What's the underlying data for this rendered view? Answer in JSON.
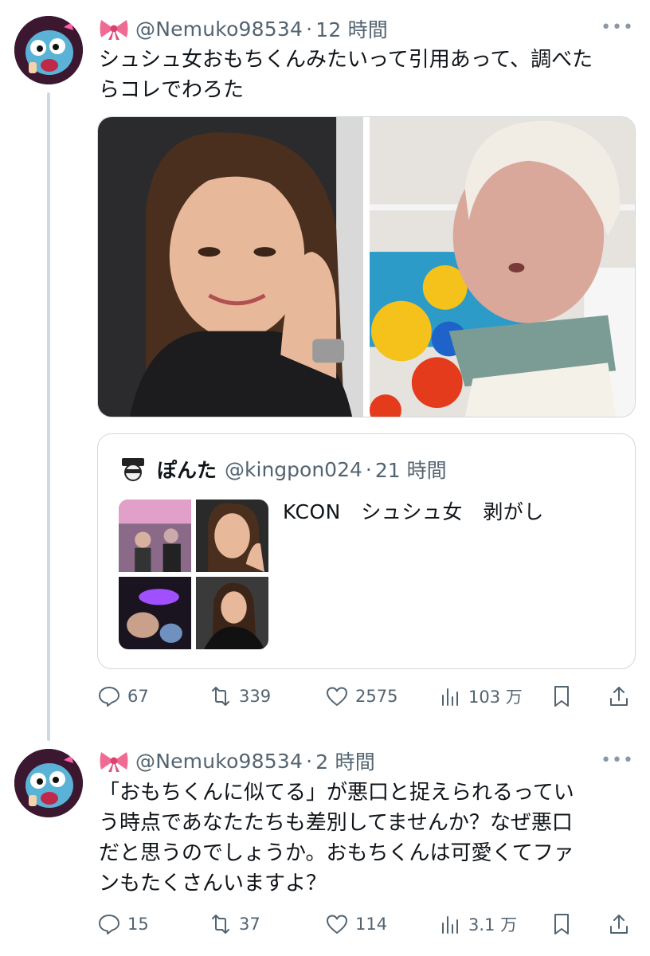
{
  "tweets": [
    {
      "handle": "@Nemuko98534",
      "separator": "·",
      "time": "12 時間",
      "text": "シュシュ女おもちくんみたいって引用あって、調べた\nらコレでわろた",
      "icons": {
        "bow": "bow-emoji",
        "more": "more-icon"
      },
      "quote": {
        "name": "ぽんた",
        "handle": "@kingpon024",
        "separator": "·",
        "time": "21 時間",
        "text": "KCON　シュシュ女　剥がし"
      },
      "actions": {
        "replies": "67",
        "retweets": "339",
        "likes": "2575",
        "views": "103 万"
      }
    },
    {
      "handle": "@Nemuko98534",
      "separator": "·",
      "time": "2 時間",
      "text": "「おもちくんに似てる」が悪口と捉えられるってい\nう時点であなたたちも差別してませんか？なぜ悪口\nだと思うのでしょうか。おもちくんは可愛くてファ\nンもたくさんいますよ？",
      "actions": {
        "replies": "15",
        "retweets": "37",
        "likes": "114",
        "views": "3.1 万"
      }
    }
  ],
  "colors": {
    "text": "#0f1419",
    "secondary": "#536471",
    "border": "#cfd9de",
    "thread_line": "#cfd9de"
  }
}
